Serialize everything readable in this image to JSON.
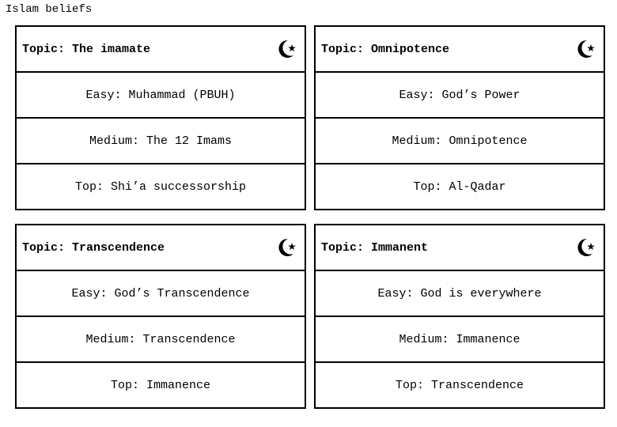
{
  "page": {
    "title": "Islam beliefs"
  },
  "cards": [
    {
      "topic": "Topic: The imamate",
      "icon": "star-and-crescent-icon",
      "easy": "Easy: Muhammad (PBUH)",
      "medium": "Medium: The 12 Imams",
      "top": "Top: Shi’a successorship"
    },
    {
      "topic": "Topic: Omnipotence",
      "icon": "star-and-crescent-icon",
      "easy": "Easy: God’s Power",
      "medium": "Medium: Omnipotence",
      "top": "Top: Al-Qadar"
    },
    {
      "topic": "Topic: Transcendence",
      "icon": "star-and-crescent-icon",
      "easy": "Easy: God’s Transcendence",
      "medium": "Medium: Transcendence",
      "top": "Top: Immanence"
    },
    {
      "topic": "Topic: Immanent",
      "icon": "star-and-crescent-icon",
      "easy": "Easy: God is everywhere",
      "medium": "Medium: Immanence",
      "top": "Top: Transcendence"
    }
  ]
}
